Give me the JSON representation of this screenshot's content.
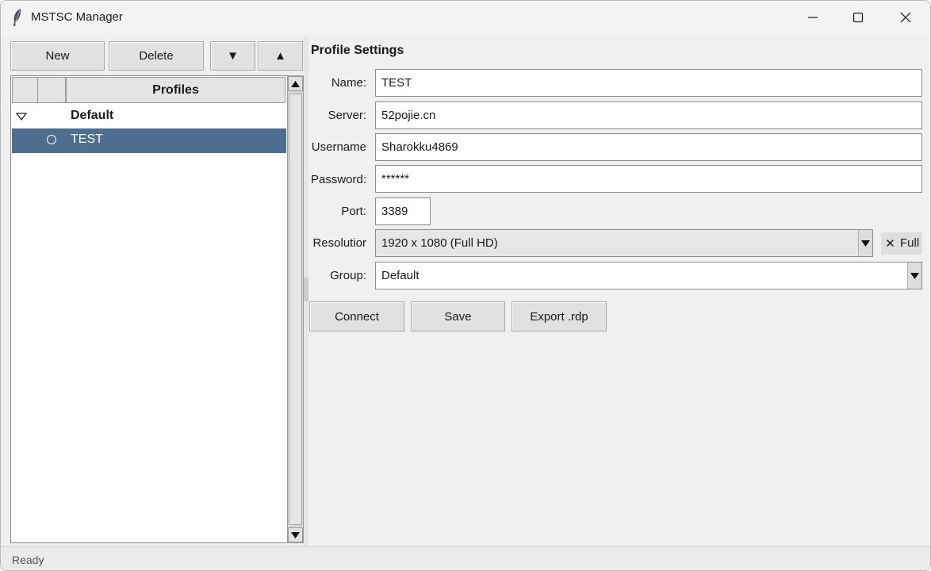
{
  "window": {
    "title": "MSTSC Manager"
  },
  "toolbar": {
    "new_label": "New",
    "delete_label": "Delete",
    "move_down_label": "▼",
    "move_up_label": "▲"
  },
  "tree": {
    "header": "Profiles",
    "groups": [
      {
        "name": "Default",
        "expanded": true,
        "items": [
          {
            "name": "TEST",
            "selected": true
          }
        ]
      }
    ]
  },
  "settings": {
    "title": "Profile Settings",
    "name": {
      "label": "Name:",
      "value": "TEST"
    },
    "server": {
      "label": "Server:",
      "value": "52pojie.cn"
    },
    "username": {
      "label": "Username",
      "value": "Sharokku4869"
    },
    "password": {
      "label": "Password:",
      "value": "******"
    },
    "port": {
      "label": "Port:",
      "value": "3389"
    },
    "resolution": {
      "label": "Resolutior",
      "value": "1920 x 1080  (Full HD)"
    },
    "full": {
      "label": "Full",
      "checked": true,
      "mark": "✕"
    },
    "group": {
      "label": "Group:",
      "value": "Default"
    }
  },
  "actions": {
    "connect_label": "Connect",
    "save_label": "Save",
    "export_label": "Export .rdp"
  },
  "status": {
    "text": "Ready"
  },
  "colors": {
    "selection": "#4d6e8e",
    "background": "#f0f0f0"
  }
}
